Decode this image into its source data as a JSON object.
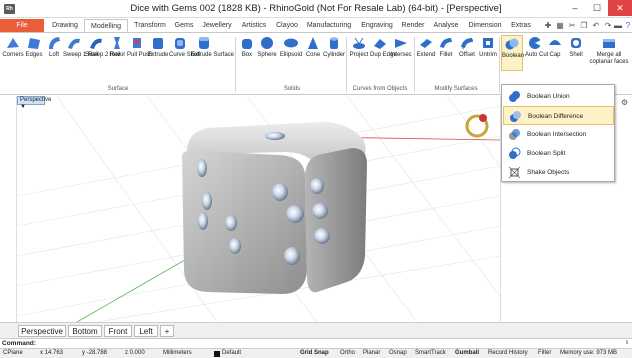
{
  "window": {
    "app_icon_text": "Rh",
    "title": "Dice with Gems 002 (1828 KB) - RhinoGold (Not For Resale Lab) (64-bit) - [Perspective]",
    "min_glyph": "–",
    "max_glyph": "☐",
    "close_glyph": "✕"
  },
  "ribbon_tabs": [
    "File",
    "Drawing",
    "Modelling",
    "Transform",
    "Gems",
    "Jewellery",
    "Artistics",
    "Clayoo",
    "Manufacturing",
    "Engraving",
    "Render",
    "Analyse",
    "Dimension",
    "Extras"
  ],
  "active_tab": "Modelling",
  "quick_access": [
    "pin-icon",
    "paste-icon",
    "cut-icon",
    "copy-icon",
    "undo-icon",
    "redo-icon",
    "save-icon",
    "help-icon"
  ],
  "surface_tools": [
    "Corners",
    "Edges",
    "Loft",
    "Sweep 1 Rail",
    "Sweep 2 Rail",
    "Revol",
    "Pull Push",
    "Extrude",
    "Curve Shell",
    "Extrude Surface"
  ],
  "solid_tools": [
    "Box",
    "Sphere",
    "Ellipsoid",
    "Cone",
    "Cylinder"
  ],
  "curves_tools": [
    "Project",
    "Dup Edge",
    "Intersec"
  ],
  "modify_tools": [
    "Extend",
    "Fillet",
    "Offset",
    "Untrim"
  ],
  "boolean_tools": [
    "Boolean",
    "Auto Cut",
    "Cap",
    "Shell",
    "Merge all coplanar faces"
  ],
  "group_labels": {
    "surface": "Surface",
    "solids": "Solids",
    "curves": "Curves from Objects",
    "modify": "Modify Surfaces"
  },
  "viewport": {
    "title": "Perspective",
    "title_dropdown": "▼"
  },
  "boolean_menu": [
    {
      "label": "Boolean Union",
      "highlighted": false
    },
    {
      "label": "Boolean Difference",
      "highlighted": true
    },
    {
      "label": "Boolean Intersection",
      "highlighted": false
    },
    {
      "label": "Boolean Split",
      "highlighted": false
    },
    {
      "label": "Shake Objects",
      "highlighted": false
    }
  ],
  "viewport_tabs": [
    "Perspective",
    "Bottom",
    "Front",
    "Left",
    "+"
  ],
  "command": {
    "label": "Command:",
    "value": ""
  },
  "status": {
    "cplane": "CPlane",
    "x": "x 14.763",
    "y": "y -28.788",
    "z": "z 0.000",
    "units": "Millimeters",
    "layer": "Default",
    "grid_snap": "Grid Snap",
    "ortho": "Ortho",
    "planar": "Planar",
    "osnap": "Osnap",
    "smarttrack": "SmartTrack",
    "gumball": "Gumball",
    "record_history": "Record History",
    "filter": "Filter",
    "memory": "Memory use: 973 MB"
  },
  "colors": {
    "file_tab": "#e85d3a",
    "close_button": "#e04343",
    "menu_highlight": "#fdf1c8",
    "viewport_title": "#cfe3f7"
  }
}
